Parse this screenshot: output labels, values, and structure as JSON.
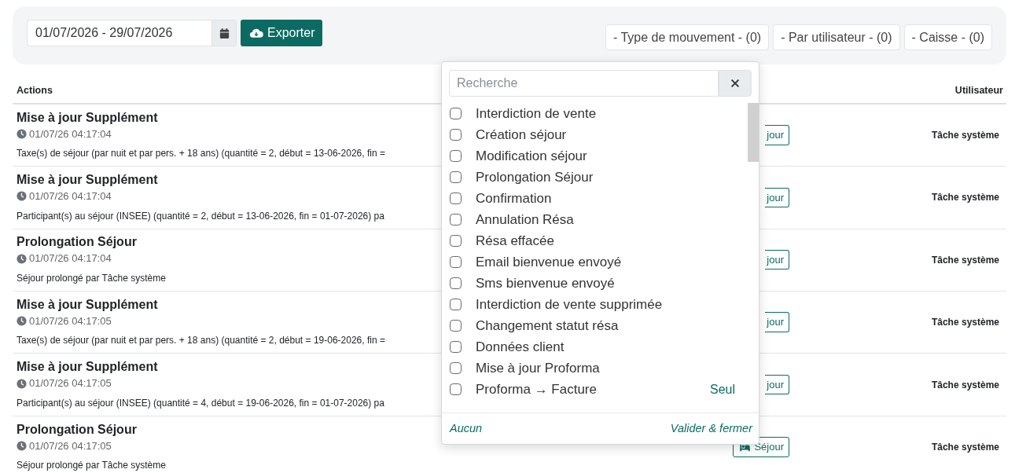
{
  "filters": {
    "date_range": "01/07/2026 - 29/07/2026",
    "export_button": "Exporter",
    "dropdowns": [
      "- Type de mouvement - (0)",
      "- Par utilisateur - (0)",
      "- Caisse - (0)"
    ]
  },
  "table": {
    "columns": [
      "Actions",
      "Utilisateur"
    ],
    "rows": [
      {
        "title": "Mise à jour Supplément",
        "time": "01/07/26 04:17:04",
        "detail": "Taxe(s) de séjour (par nuit et par pers. + 18 ans) (quantité = 2, début = 13-06-2026, fin =",
        "action_button": "jour",
        "covered": true,
        "user": "Tâche système"
      },
      {
        "title": "Mise à jour Supplément",
        "time": "01/07/26 04:17:04",
        "detail": "Participant(s) au séjour (INSEE) (quantité = 2, début = 13-06-2026, fin = 01-07-2026) pa",
        "action_button": "jour",
        "covered": true,
        "user": "Tâche système"
      },
      {
        "title": "Prolongation Séjour",
        "time": "01/07/26 04:17:04",
        "detail": "Séjour prolongé par Tâche système",
        "action_button": "jour",
        "covered": true,
        "user": "Tâche système"
      },
      {
        "title": "Mise à jour Supplément",
        "time": "01/07/26 04:17:05",
        "detail": "Taxe(s) de séjour (par nuit et par pers. + 18 ans) (quantité = 2, début = 19-06-2026, fin =",
        "action_button": "jour",
        "covered": true,
        "user": "Tâche système"
      },
      {
        "title": "Mise à jour Supplément",
        "time": "01/07/26 04:17:05",
        "detail": "Participant(s) au séjour (INSEE) (quantité = 4, début = 19-06-2026, fin = 01-07-2026) pa",
        "action_button": "jour",
        "covered": true,
        "user": "Tâche système"
      },
      {
        "title": "Prolongation Séjour",
        "time": "01/07/26 04:17:05",
        "detail": "Séjour prolongé par Tâche système",
        "action_button": "Séjour",
        "covered": false,
        "user": "Tâche système"
      }
    ]
  },
  "dropdown_menu": {
    "search_placeholder": "Recherche",
    "items": [
      {
        "label": "Interdiction de vente",
        "checked": false
      },
      {
        "label": "Création séjour",
        "checked": false
      },
      {
        "label": "Modification séjour",
        "checked": false
      },
      {
        "label": "Prolongation Séjour",
        "checked": false
      },
      {
        "label": "Confirmation",
        "checked": false
      },
      {
        "label": "Annulation Résa",
        "checked": false
      },
      {
        "label": "Résa effacée",
        "checked": false
      },
      {
        "label": "Email bienvenue envoyé",
        "checked": false
      },
      {
        "label": "Sms bienvenue envoyé",
        "checked": false
      },
      {
        "label": "Interdiction de vente supprimée",
        "checked": false
      },
      {
        "label": "Changement statut résa",
        "checked": false
      },
      {
        "label": "Données client",
        "checked": false
      },
      {
        "label": "Mise à jour Proforma",
        "checked": false
      },
      {
        "label": "Proforma → Facture",
        "checked": false,
        "only_link": "Seul"
      }
    ],
    "footer_left": "Aucun",
    "footer_right": "Valider & fermer"
  }
}
